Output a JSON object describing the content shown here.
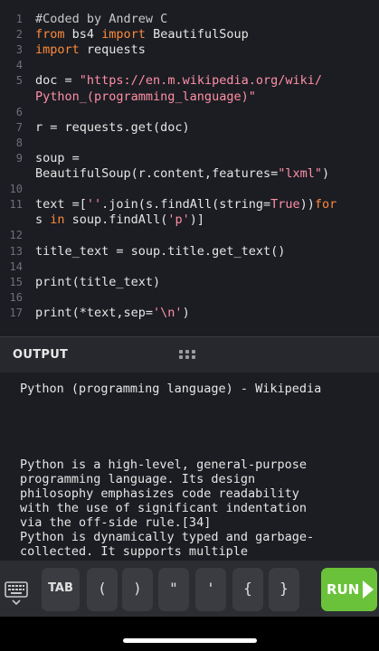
{
  "editor": {
    "lines": [
      {
        "n": "1",
        "segs": [
          {
            "t": "#Coded by Andrew C",
            "c": "cm"
          }
        ]
      },
      {
        "n": "2",
        "segs": [
          {
            "t": "from",
            "c": "kw"
          },
          {
            "t": " bs4 ",
            "c": ""
          },
          {
            "t": "import",
            "c": "kw"
          },
          {
            "t": " BeautifulSoup",
            "c": ""
          }
        ]
      },
      {
        "n": "3",
        "segs": [
          {
            "t": "import",
            "c": "kw"
          },
          {
            "t": " requests",
            "c": ""
          }
        ]
      },
      {
        "n": "4",
        "segs": []
      },
      {
        "n": "5",
        "segs": [
          {
            "t": "doc = ",
            "c": ""
          },
          {
            "t": "\"https://en.m.wikipedia.org/wiki/",
            "c": "str"
          }
        ]
      },
      {
        "n": "",
        "segs": [
          {
            "t": "Python_(programming_language)\"",
            "c": "str"
          }
        ]
      },
      {
        "n": "6",
        "segs": []
      },
      {
        "n": "7",
        "segs": [
          {
            "t": "r = requests.get(doc)",
            "c": ""
          }
        ]
      },
      {
        "n": "8",
        "segs": []
      },
      {
        "n": "9",
        "segs": [
          {
            "t": "soup =",
            "c": ""
          }
        ]
      },
      {
        "n": "",
        "segs": [
          {
            "t": "BeautifulSoup(r.content,features=",
            "c": ""
          },
          {
            "t": "\"lxml\"",
            "c": "str"
          },
          {
            "t": ")",
            "c": ""
          }
        ]
      },
      {
        "n": "10",
        "segs": []
      },
      {
        "n": "11",
        "segs": [
          {
            "t": "text =[",
            "c": ""
          },
          {
            "t": "''",
            "c": "str"
          },
          {
            "t": ".join(s.findAll(string=",
            "c": ""
          },
          {
            "t": "True",
            "c": "str"
          },
          {
            "t": "))",
            "c": ""
          },
          {
            "t": "for",
            "c": "kw"
          }
        ]
      },
      {
        "n": "",
        "segs": [
          {
            "t": "s ",
            "c": ""
          },
          {
            "t": "in",
            "c": "kw"
          },
          {
            "t": " soup.findAll(",
            "c": ""
          },
          {
            "t": "'p'",
            "c": "str"
          },
          {
            "t": ")]",
            "c": ""
          }
        ]
      },
      {
        "n": "12",
        "segs": []
      },
      {
        "n": "13",
        "segs": [
          {
            "t": "title_text = soup.title.get_text()",
            "c": ""
          }
        ]
      },
      {
        "n": "14",
        "segs": []
      },
      {
        "n": "15",
        "segs": [
          {
            "t": "print(title_text)",
            "c": ""
          }
        ]
      },
      {
        "n": "16",
        "segs": []
      },
      {
        "n": "17",
        "segs": [
          {
            "t": "print(*text,sep=",
            "c": ""
          },
          {
            "t": "'\\n'",
            "c": "str"
          },
          {
            "t": ")",
            "c": ""
          }
        ]
      }
    ]
  },
  "output": {
    "title": "OUTPUT",
    "lines": [
      "Python (programming language) - Wikipedia",
      "",
      "",
      "",
      "",
      "Python is a high-level, general-purpose",
      "programming language. Its design",
      "philosophy emphasizes code readability",
      "with the use of significant indentation",
      "via the off-side rule.[34]",
      "Python is dynamically typed and garbage-",
      "collected. It supports multiple"
    ]
  },
  "keyboard": {
    "toggle_icon": "keyboard-icon",
    "tab_label": "TAB",
    "keys": [
      "(",
      ")",
      "\"",
      "'",
      "{",
      "}"
    ]
  },
  "run": {
    "label": "RUN",
    "icon": "play-arrow-icon",
    "color": "#6ac23a"
  }
}
